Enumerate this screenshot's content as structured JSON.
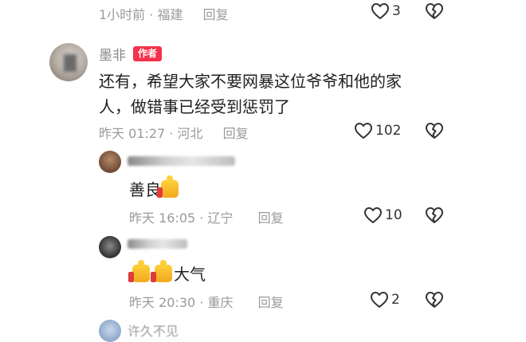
{
  "top_comment": {
    "time": "1小时前",
    "location": "福建",
    "reply_label": "回复",
    "like_count": "3"
  },
  "main_comment": {
    "username": "墨非",
    "author_badge": "作者",
    "text_line1": "还有，希望大家不要网暴这位爷爷和他的家",
    "text_line2": "人，做错事已经受到惩罚了",
    "time": "昨天 01:27",
    "location": "河北",
    "reply_label": "回复",
    "like_count": "102"
  },
  "replies": [
    {
      "text": "善良",
      "emoji": "thumbs-up",
      "time": "昨天 16:05",
      "location": "辽宁",
      "reply_label": "回复",
      "like_count": "10"
    },
    {
      "text": "大气",
      "emoji": "thumbs-up x2",
      "time": "昨天 20:30",
      "location": "重庆",
      "reply_label": "回复",
      "like_count": "2"
    }
  ],
  "partial_comment": {
    "username": "许久不见"
  },
  "colors": {
    "badge": "#f5334d",
    "meta_text": "#9a9a9a"
  },
  "icons": [
    "heart-outline-icon",
    "broken-heart-icon",
    "thumbs-up-emoji"
  ]
}
